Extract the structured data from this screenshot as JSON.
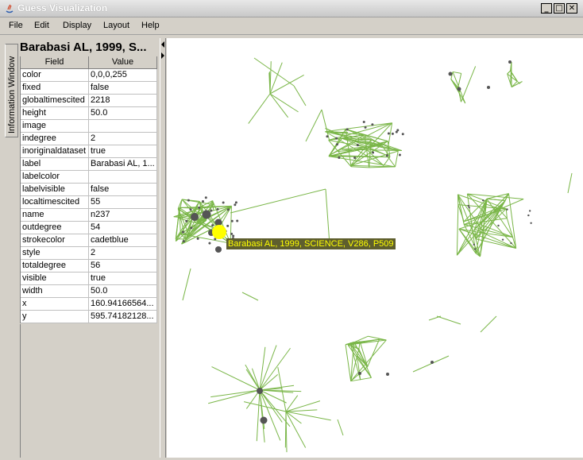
{
  "window": {
    "title": "Guess Visualization"
  },
  "menu": [
    "File",
    "Edit",
    "Display",
    "Layout",
    "Help"
  ],
  "side_tab": {
    "label": "Information Window"
  },
  "panel": {
    "title": "Barabasi AL, 1999, S...",
    "columns": [
      "Field",
      "Value"
    ],
    "rows": [
      {
        "field": "color",
        "value": "0,0,0,255"
      },
      {
        "field": "fixed",
        "value": "false"
      },
      {
        "field": "globaltimescited",
        "value": "2218"
      },
      {
        "field": "height",
        "value": "50.0"
      },
      {
        "field": "image",
        "value": ""
      },
      {
        "field": "indegree",
        "value": "2"
      },
      {
        "field": "inoriginaldataset",
        "value": "true"
      },
      {
        "field": "label",
        "value": "Barabasi AL, 1..."
      },
      {
        "field": "labelcolor",
        "value": ""
      },
      {
        "field": "labelvisible",
        "value": "false"
      },
      {
        "field": "localtimescited",
        "value": "55"
      },
      {
        "field": "name",
        "value": "n237"
      },
      {
        "field": "outdegree",
        "value": "54"
      },
      {
        "field": "strokecolor",
        "value": "cadetblue"
      },
      {
        "field": "style",
        "value": "2"
      },
      {
        "field": "totaldegree",
        "value": "56"
      },
      {
        "field": "visible",
        "value": "true"
      },
      {
        "field": "width",
        "value": "50.0"
      },
      {
        "field": "x",
        "value": "160.94166564..."
      },
      {
        "field": "y",
        "value": "595.74182128..."
      }
    ]
  },
  "graph": {
    "tooltip": "Barabasi AL, 1999, SCIENCE, V286, P509",
    "edge_color": "#7ab648",
    "node_color": "#555555",
    "highlight_color": "#ffff00"
  }
}
